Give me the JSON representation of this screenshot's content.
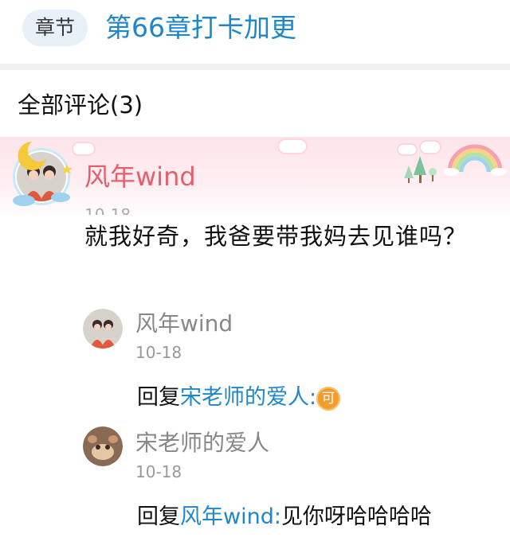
{
  "chapter": {
    "chip_label": "章节",
    "title": "第66章打卡加更"
  },
  "comments_header": "全部评论(3)",
  "main_comment": {
    "author": "风年wind",
    "date": "10-18",
    "text": "就我好奇，我爸要带我妈去见谁吗？"
  },
  "replies": [
    {
      "author": "风年wind",
      "date": "10-18",
      "prefix": "回复",
      "mention": "宋老师的爱人:",
      "body": "",
      "emoji": "可"
    },
    {
      "author": "宋老师的爱人",
      "date": "10-18",
      "prefix": "回复",
      "mention": "风年wind:",
      "body": "见你呀哈哈哈哈"
    }
  ],
  "colors": {
    "accent": "#1f86c8",
    "author_highlight": "#e85d6b",
    "chip_bg": "#e8f1f8"
  },
  "icons": [
    "crescent-moon-icon",
    "rainbow-icon",
    "cloud-icon",
    "tree-icon",
    "emoji-ke-icon"
  ]
}
